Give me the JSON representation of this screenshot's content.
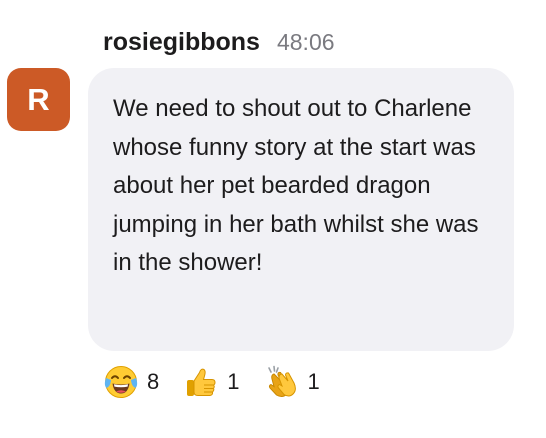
{
  "message": {
    "avatar_letter": "R",
    "avatar_color": "#cc5a26",
    "username": "rosiegibbons",
    "timestamp": "48:06",
    "body": "We need to shout out to Charlene whose funny story at the start was about her pet bearded dragon jumping in her bath whilst she was in the shower!",
    "bubble_color": "#f1f1f5"
  },
  "reactions": [
    {
      "icon": "tears-of-joy-emoji-icon",
      "count": "8"
    },
    {
      "icon": "thumbs-up-emoji-icon",
      "count": "1"
    },
    {
      "icon": "clapping-hands-emoji-icon",
      "count": "1"
    }
  ]
}
